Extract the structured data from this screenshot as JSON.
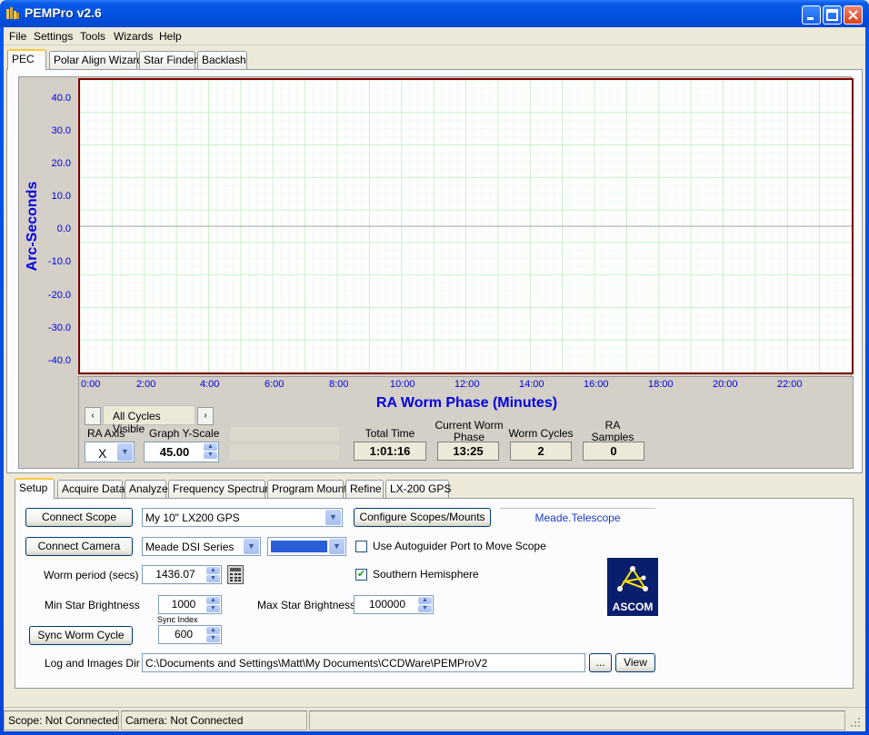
{
  "window": {
    "title": "PEMPro v2.6"
  },
  "menu": [
    "File",
    "Settings",
    "Tools",
    "Wizards",
    "Help"
  ],
  "top_tabs": [
    "PEC",
    "Polar Align Wizard",
    "Star Finder",
    "Backlash"
  ],
  "graph": {
    "y_title": "Arc-Seconds",
    "x_title": "RA Worm Phase (Minutes)",
    "y_ticks": [
      "40.0",
      "30.0",
      "20.0",
      "10.0",
      "0.0",
      "-10.0",
      "-20.0",
      "-30.0",
      "-40.0"
    ],
    "x_ticks": [
      "0:00",
      "2:00",
      "4:00",
      "6:00",
      "8:00",
      "10:00",
      "12:00",
      "14:00",
      "16:00",
      "18:00",
      "20:00",
      "22:00"
    ],
    "cycles_label": "All Cycles Visible",
    "prev_arrow": "‹",
    "next_arrow": "›",
    "ra_axis_label": "RA Axis",
    "ra_axis_value": "X",
    "y_scale_label": "Graph Y-Scale",
    "y_scale_value": "45.00",
    "total_time_label": "Total Time",
    "total_time_value": "1:01:16",
    "worm_phase_label_1": "Current Worm",
    "worm_phase_label_2": "Phase",
    "worm_phase_value": "13:25",
    "worm_cycles_label": "Worm Cycles",
    "worm_cycles_value": "2",
    "ra_samples_label_1": "RA",
    "ra_samples_label_2": "Samples",
    "ra_samples_value": "0"
  },
  "setup_tabs": [
    "Setup",
    "Acquire Data",
    "Analyze",
    "Frequency Spectrum",
    "Program Mount",
    "Refine",
    "LX-200 GPS"
  ],
  "setup": {
    "connect_scope": "Connect Scope",
    "scope_select": "My 10\" LX200 GPS",
    "configure_scopes": "Configure Scopes/Mounts",
    "driver_name": "Meade.Telescope",
    "connect_camera": "Connect Camera",
    "camera_select": "Meade DSI Series",
    "use_autoguider": "Use Autoguider Port to Move Scope",
    "worm_period_label": "Worm period (secs)",
    "worm_period_value": "1436.07",
    "southern_hemisphere": "Southern Hemisphere",
    "min_star_label": "Min Star Brightness",
    "min_star_value": "1000",
    "max_star_label": "Max Star Brightness",
    "max_star_value": "100000",
    "sync_index_label": "Sync Index",
    "sync_worm_cycle": "Sync Worm Cycle",
    "sync_index_value": "600",
    "log_dir_label": "Log and Images Dir",
    "log_dir_value": "C:\\Documents and Settings\\Matt\\My Documents\\CCDWare\\PEMProV2",
    "browse_label": "...",
    "view_label": "View",
    "ascom_logo_text": "ASCOM"
  },
  "status": {
    "scope": "Scope: Not Connected",
    "camera": "Camera: Not Connected"
  },
  "colors": {
    "axis_text": "#0000e0",
    "plot_border": "#800000",
    "grid": "#c8f0c8"
  }
}
